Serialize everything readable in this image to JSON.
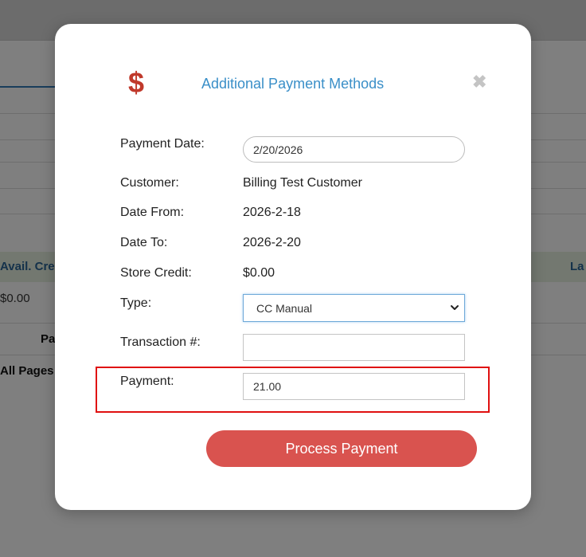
{
  "background": {
    "header_left": "Avail. Cre",
    "header_right": "La",
    "row_value": "$0.00",
    "pa_label": "Pa",
    "all_pages": "All Pages"
  },
  "modal": {
    "icon": "dollar-icon",
    "title": "Additional Payment Methods",
    "close_icon": "close-icon",
    "payment_date": {
      "label": "Payment Date:",
      "value": "2/20/2026"
    },
    "customer": {
      "label": "Customer:",
      "value": "Billing Test Customer"
    },
    "date_from": {
      "label": "Date From:",
      "value": "2026-2-18"
    },
    "date_to": {
      "label": "Date To:",
      "value": "2026-2-20"
    },
    "store_credit": {
      "label": "Store Credit:",
      "value": "$0.00"
    },
    "type": {
      "label": "Type:",
      "selected": "CC Manual"
    },
    "transaction": {
      "label": "Transaction #:",
      "value": ""
    },
    "payment": {
      "label": "Payment:",
      "value": "21.00"
    },
    "process_button": "Process Payment"
  },
  "colors": {
    "title": "#3a8fc8",
    "icon": "#c0392b",
    "button": "#d9534f",
    "highlight": "#e01010"
  }
}
